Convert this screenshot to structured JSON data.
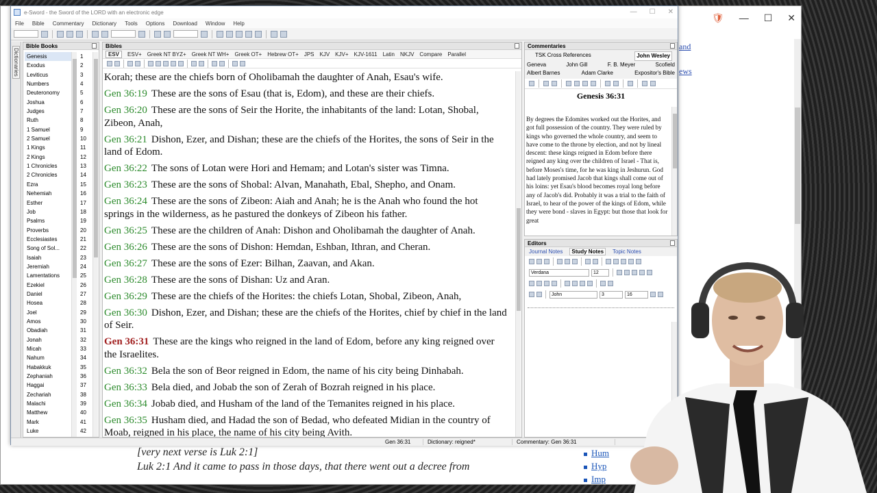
{
  "window": {
    "title": "e-Sword - the Sword of the LORD with an electronic edge",
    "menu": [
      "File",
      "Bible",
      "Commentary",
      "Dictionary",
      "Tools",
      "Options",
      "Download",
      "Window",
      "Help"
    ],
    "controls": [
      "—",
      "☐",
      "✕"
    ]
  },
  "background_window": {
    "links": [
      "and",
      "ews"
    ],
    "text_lines": [
      "[very next verse is Luk 2:1]",
      "Luk 2:1 And it came to pass in those days, that there went out a decree from"
    ],
    "side_links": [
      "Hum",
      "Hyp",
      "Imp"
    ]
  },
  "dictionary_strip": {
    "label": "Dictionaries"
  },
  "bible_books": {
    "title": "Bible Books",
    "books": [
      "Genesis",
      "Exodus",
      "Leviticus",
      "Numbers",
      "Deuteronomy",
      "Joshua",
      "Judges",
      "Ruth",
      "1 Samuel",
      "2 Samuel",
      "1 Kings",
      "2 Kings",
      "1 Chronicles",
      "2 Chronicles",
      "Ezra",
      "Nehemiah",
      "Esther",
      "Job",
      "Psalms",
      "Proverbs",
      "Ecclesiastes",
      "Song of Sol...",
      "Isaiah",
      "Jeremiah",
      "Lamentations",
      "Ezekiel",
      "Daniel",
      "Hosea",
      "Joel",
      "Amos",
      "Obadiah",
      "Jonah",
      "Micah",
      "Nahum",
      "Habakkuk",
      "Zephaniah",
      "Haggai",
      "Zechariah",
      "Malachi",
      "Matthew",
      "Mark",
      "Luke"
    ],
    "chapters": [
      "1",
      "2",
      "3",
      "4",
      "5",
      "6",
      "7",
      "8",
      "9",
      "10",
      "11",
      "12",
      "13",
      "14",
      "15",
      "16",
      "17",
      "18",
      "19",
      "20",
      "21",
      "22",
      "23",
      "24",
      "25",
      "26",
      "27",
      "28",
      "29",
      "30",
      "31",
      "32",
      "33",
      "34",
      "35",
      "36",
      "37",
      "38",
      "39",
      "40",
      "41",
      "42"
    ],
    "selected_book": "Genesis"
  },
  "bibles": {
    "title": "Bibles",
    "tabs": [
      "ESV",
      "ESV+",
      "Greek NT BYZ+",
      "Greek NT WH+",
      "Greek OT+",
      "Hebrew OT+",
      "JPS",
      "KJV",
      "KJV+",
      "KJV-1611",
      "Latin",
      "NKJV",
      "Compare",
      "Parallel"
    ],
    "active_tab": "ESV",
    "verses": [
      {
        "ref": "",
        "text": "Korah; these are the chiefs born of Oholibamah the daughter of Anah, Esau's wife."
      },
      {
        "ref": "Gen 36:19",
        "text": "These are the sons of Esau (that is, Edom), and these are their chiefs."
      },
      {
        "ref": "Gen 36:20",
        "text": "These are the sons of Seir the Horite, the inhabitants of the land: Lotan, Shobal, Zibeon, Anah,"
      },
      {
        "ref": "Gen 36:21",
        "text": "Dishon, Ezer, and Dishan; these are the chiefs of the Horites, the sons of Seir in the land of Edom."
      },
      {
        "ref": "Gen 36:22",
        "text": "The sons of Lotan were Hori and Hemam; and Lotan's sister was Timna."
      },
      {
        "ref": "Gen 36:23",
        "text": "These are the sons of Shobal: Alvan, Manahath, Ebal, Shepho, and Onam."
      },
      {
        "ref": "Gen 36:24",
        "text": "These are the sons of Zibeon: Aiah and Anah; he is the Anah who found the hot springs in the wilderness, as he pastured the donkeys of Zibeon his father."
      },
      {
        "ref": "Gen 36:25",
        "text": "These are the children of Anah: Dishon and Oholibamah the daughter of Anah."
      },
      {
        "ref": "Gen 36:26",
        "text": "These are the sons of Dishon: Hemdan, Eshban, Ithran, and Cheran."
      },
      {
        "ref": "Gen 36:27",
        "text": "These are the sons of Ezer: Bilhan, Zaavan, and Akan."
      },
      {
        "ref": "Gen 36:28",
        "text": "These are the sons of Dishan: Uz and Aran."
      },
      {
        "ref": "Gen 36:29",
        "text": "These are the chiefs of the Horites: the chiefs Lotan, Shobal, Zibeon, Anah,"
      },
      {
        "ref": "Gen 36:30",
        "text": "Dishon, Ezer, and Dishan; these are the chiefs of the Horites, chief by chief in the land of Seir."
      },
      {
        "ref": "Gen 36:31",
        "text": "These are the kings who reigned in the land of Edom, before any king reigned over the Israelites.",
        "current": true
      },
      {
        "ref": "Gen 36:32",
        "text": "Bela the son of Beor reigned in Edom, the name of his city being Dinhabah."
      },
      {
        "ref": "Gen 36:33",
        "text": "Bela died, and Jobab the son of Zerah of Bozrah reigned in his place."
      },
      {
        "ref": "Gen 36:34",
        "text": "Jobab died, and Husham of the land of the Temanites reigned in his place."
      },
      {
        "ref": "Gen 36:35",
        "text": "Husham died, and Hadad the son of Bedad, who defeated Midian in the country of Moab, reigned in his place, the name of his city being Avith."
      }
    ]
  },
  "commentaries": {
    "title": "Commentaries",
    "tabs_row1": [
      "TSK Cross References",
      "John Wesley"
    ],
    "tabs_row2": [
      "Geneva",
      "John Gill",
      "F. B. Meyer",
      "Scofield"
    ],
    "tabs_row3": [
      "Albert Barnes",
      "Adam Clarke",
      "Expositor's Bible"
    ],
    "active_tab": "John Wesley",
    "heading": "Genesis 36:31",
    "body": "By degrees the Edomites worked out the Horites, and got full possession of the country. They were ruled by kings who governed the whole country, and seem to have come to the throne by election, and not by lineal descent: these kings reigned in Edom before there reigned any king over the children of Israel - That is, before Moses's time, for he was king in Jeshurun. God had lately promised Jacob that kings shall come out of his loins: yet Esau's blood becomes royal long before any of Jacob's did. Probably it was a trial to the faith of Israel, to hear of the power of the kings of Edom, while they were bond - slaves in Egypt: but those that look for great"
  },
  "editors": {
    "title": "Editors",
    "tabs": [
      "Journal Notes",
      "Study Notes",
      "Topic Notes"
    ],
    "active_tab": "Study Notes",
    "font": "Verdana",
    "size": "12",
    "book_select": "John",
    "chapter_select": "3",
    "verse_select": "16"
  },
  "status": {
    "verse": "Gen 36:31",
    "dictionary": "Dictionary: reigned*",
    "commentary": "Commentary: Gen 36:31"
  },
  "colors": {
    "verse_ref": "#2b8a2b",
    "current_ref": "#a01e1e",
    "accent": "#4a7cc0"
  }
}
